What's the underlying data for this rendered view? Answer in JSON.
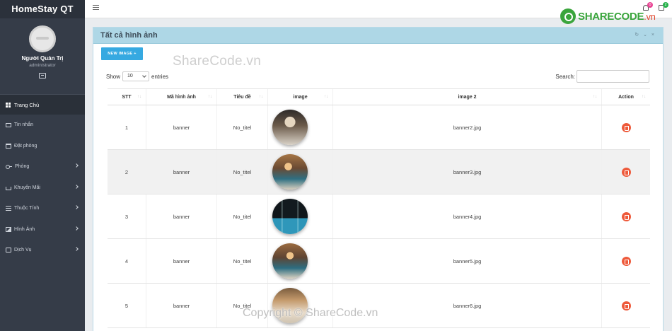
{
  "brand": "HomeStay QT",
  "profile": {
    "name": "Người Quản Trị",
    "role": "administrator"
  },
  "menu": [
    {
      "label": "Trang Chủ",
      "icon": "dashboard-icon",
      "active": true,
      "has_children": false
    },
    {
      "label": "Tin nhắn",
      "icon": "envelope-icon",
      "active": false,
      "has_children": false
    },
    {
      "label": "Đặt phòng",
      "icon": "calendar-icon",
      "active": false,
      "has_children": false
    },
    {
      "label": "Phòng",
      "icon": "key-icon",
      "active": false,
      "has_children": true
    },
    {
      "label": "Khuyến Mãi",
      "icon": "basket-icon",
      "active": false,
      "has_children": true
    },
    {
      "label": "Thuộc Tính",
      "icon": "list-icon",
      "active": false,
      "has_children": true
    },
    {
      "label": "Hình Ảnh",
      "icon": "image-icon",
      "active": false,
      "has_children": true
    },
    {
      "label": "Dịch Vụ",
      "icon": "service-icon",
      "active": false,
      "has_children": true
    }
  ],
  "topbar": {
    "notifications_count": "0",
    "messages_count": "2"
  },
  "watermark": {
    "logo_main": "SHARECODE",
    "logo_suffix": ".vn",
    "top": "ShareCode.vn",
    "bottom": "Copyright © ShareCode.vn"
  },
  "card": {
    "title": "Tất cả hình ảnh",
    "tools": "↻ ⌄ ×",
    "new_button": "NEW IMAGE +"
  },
  "table_controls": {
    "show_label": "Show",
    "page_size": "10",
    "entries_label": "entries",
    "search_label": "Search:"
  },
  "table": {
    "headers": [
      "STT",
      "Mã hình ảnh",
      "Tiêu đề",
      "image",
      "image 2",
      "Action"
    ],
    "rows": [
      {
        "stt": "1",
        "code": "banner",
        "title": "No_titel",
        "image2": "banner2.jpg"
      },
      {
        "stt": "2",
        "code": "banner",
        "title": "No_titel",
        "image2": "banner3.jpg"
      },
      {
        "stt": "3",
        "code": "banner",
        "title": "No_titel",
        "image2": "banner4.jpg"
      },
      {
        "stt": "4",
        "code": "banner",
        "title": "No_titel",
        "image2": "banner5.jpg"
      },
      {
        "stt": "5",
        "code": "banner",
        "title": "No_titel",
        "image2": "banner6.jpg"
      }
    ]
  },
  "colors": {
    "sidebar": "#353c48",
    "card_header": "#aed7e6",
    "primary_button": "#36a9e1",
    "delete_button": "#ee5a3b"
  }
}
